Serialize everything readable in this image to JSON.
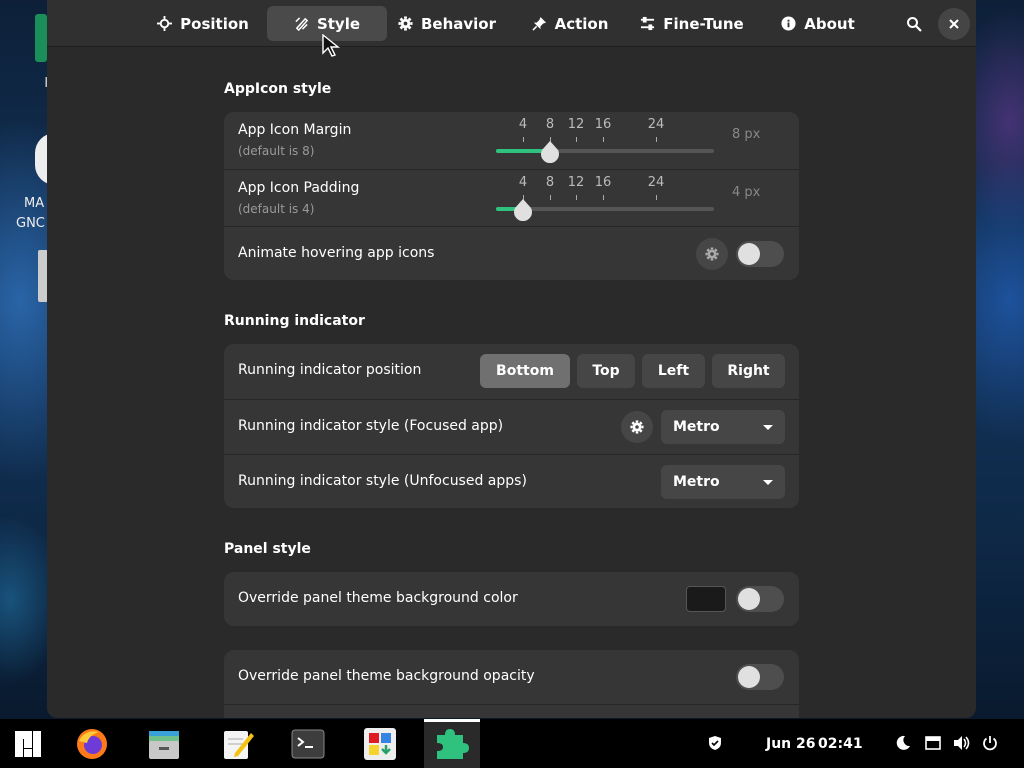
{
  "desktop": {
    "icon_label_1": "MA",
    "icon_label_2": "GNC"
  },
  "header": {
    "tabs": [
      {
        "label": "Position",
        "icon": "crosshair-icon"
      },
      {
        "label": "Style",
        "icon": "palette-brush-icon",
        "active": true
      },
      {
        "label": "Behavior",
        "icon": "gear-icon"
      },
      {
        "label": "Action",
        "icon": "pin-icon"
      },
      {
        "label": "Fine-Tune",
        "icon": "tune-icon"
      },
      {
        "label": "About",
        "icon": "info-icon"
      }
    ],
    "search_icon": "search-icon",
    "close_icon": "close-icon"
  },
  "appicon_style": {
    "title": "AppIcon style",
    "margin": {
      "label": "App Icon Margin",
      "sub": "(default is 8)",
      "ticks": [
        "4",
        "8",
        "12",
        "16",
        "24"
      ],
      "value": 8,
      "value_label": "8 px"
    },
    "padding": {
      "label": "App Icon Padding",
      "sub": "(default is 4)",
      "ticks": [
        "4",
        "8",
        "12",
        "16",
        "24"
      ],
      "value": 4,
      "value_label": "4 px"
    },
    "animate": {
      "label": "Animate hovering app icons",
      "enabled": false
    }
  },
  "running_indicator": {
    "title": "Running indicator",
    "position": {
      "label": "Running indicator position",
      "options": [
        "Bottom",
        "Top",
        "Left",
        "Right"
      ],
      "selected": "Bottom"
    },
    "focused": {
      "label": "Running indicator style (Focused app)",
      "value": "Metro"
    },
    "unfocused": {
      "label": "Running indicator style (Unfocused apps)",
      "value": "Metro"
    }
  },
  "panel_style": {
    "title": "Panel style",
    "override_bg_color": {
      "label": "Override panel theme background color",
      "enabled": false,
      "color": "#1a1a1a"
    },
    "override_bg_opacity": {
      "label": "Override panel theme background opacity",
      "enabled": false
    }
  },
  "colors": {
    "accent": "#2ec27e",
    "window_bg": "#2a2a2a",
    "card_bg": "#363636"
  },
  "taskbar": {
    "apps": [
      "manjaro-menu-icon",
      "firefox-icon",
      "files-icon",
      "text-editor-icon",
      "terminal-icon",
      "software-center-icon",
      "extensions-icon"
    ],
    "date": "Jun 26",
    "time": "02:41"
  }
}
